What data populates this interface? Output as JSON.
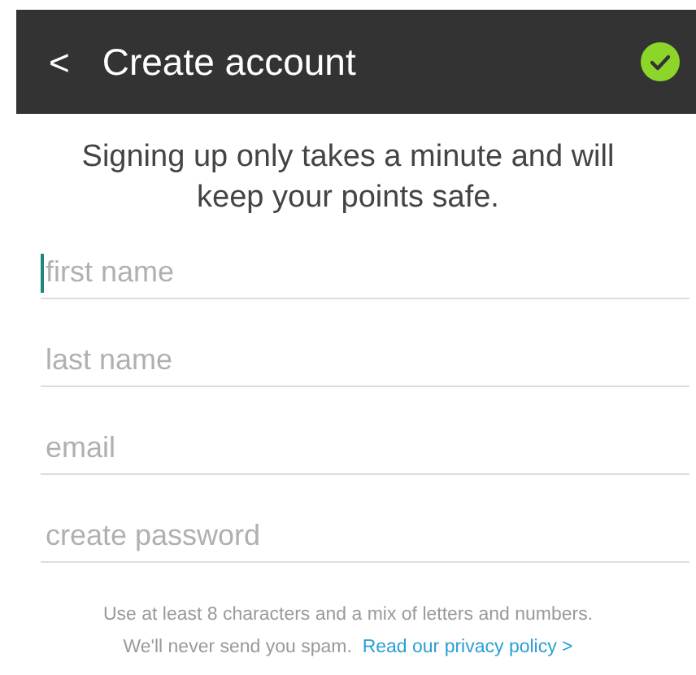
{
  "header": {
    "back": "<",
    "title": "Create account"
  },
  "intro": "Signing up only takes a minute and will keep your points safe.",
  "fields": [
    {
      "placeholder": "first name",
      "focused": true
    },
    {
      "placeholder": "last name",
      "focused": false
    },
    {
      "placeholder": "email",
      "focused": false
    },
    {
      "placeholder": "create password",
      "focused": false
    }
  ],
  "hint": "Use at least 8 characters and a mix of letters and numbers.",
  "spam_note": "We'll never send you spam.",
  "privacy_link": "Read our privacy policy >"
}
